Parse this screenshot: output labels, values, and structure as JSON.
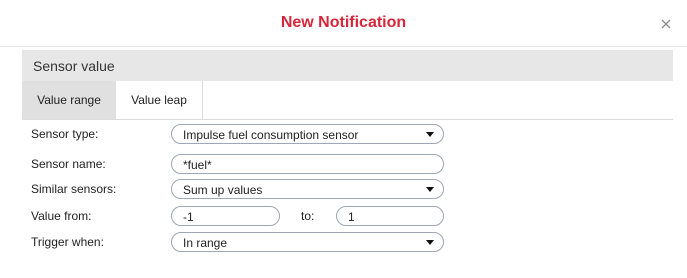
{
  "dialog": {
    "title": "New Notification",
    "title_color": "#d6263a",
    "close_icon": "close-icon"
  },
  "section": {
    "header": "Sensor value"
  },
  "tabs": [
    {
      "label": "Value range",
      "active": true
    },
    {
      "label": "Value leap",
      "active": false
    }
  ],
  "form": {
    "sensor_type": {
      "label": "Sensor type:",
      "value": "Impulse fuel consumption sensor"
    },
    "sensor_name": {
      "label": "Sensor name:",
      "value": "*fuel*"
    },
    "similar_sensors": {
      "label": "Similar sensors:",
      "value": "Sum up values"
    },
    "value_from": {
      "label": "Value from:",
      "from": "-1",
      "to_label": "to:",
      "to": "1"
    },
    "trigger_when": {
      "label": "Trigger when:",
      "value": "In range"
    }
  }
}
